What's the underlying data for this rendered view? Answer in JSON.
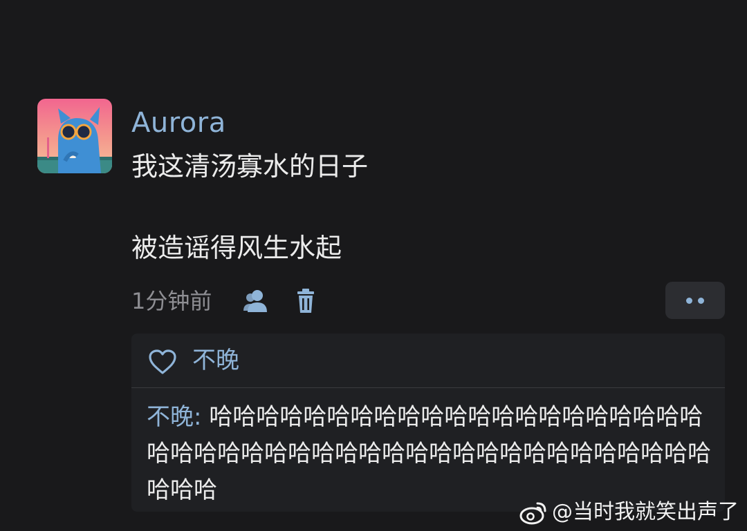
{
  "post": {
    "username": "Aurora",
    "line_1": "我这清汤寡水的日子",
    "line_2": "被造谣得风生水起",
    "time": "1分钟前",
    "icons": {
      "visibility": "person-icon",
      "delete": "trash-icon",
      "more": "more-dots-icon"
    }
  },
  "interactions": {
    "likes": [
      "不晚"
    ],
    "comments": [
      {
        "author": "不晚",
        "separator": ": ",
        "text": "哈哈哈哈哈哈哈哈哈哈哈哈哈哈哈哈哈哈哈哈哈哈哈哈哈哈哈哈哈哈哈哈哈哈哈哈哈哈哈哈哈哈哈哈哈哈哈哈"
      }
    ]
  },
  "watermark": {
    "text": "@当时我就笑出声了",
    "icon": "weibo-icon"
  },
  "colors": {
    "background": "#19191b",
    "accent": "#8fb4d8",
    "text": "#ececec",
    "muted": "#8e8e93",
    "panel": "#1f2023"
  }
}
